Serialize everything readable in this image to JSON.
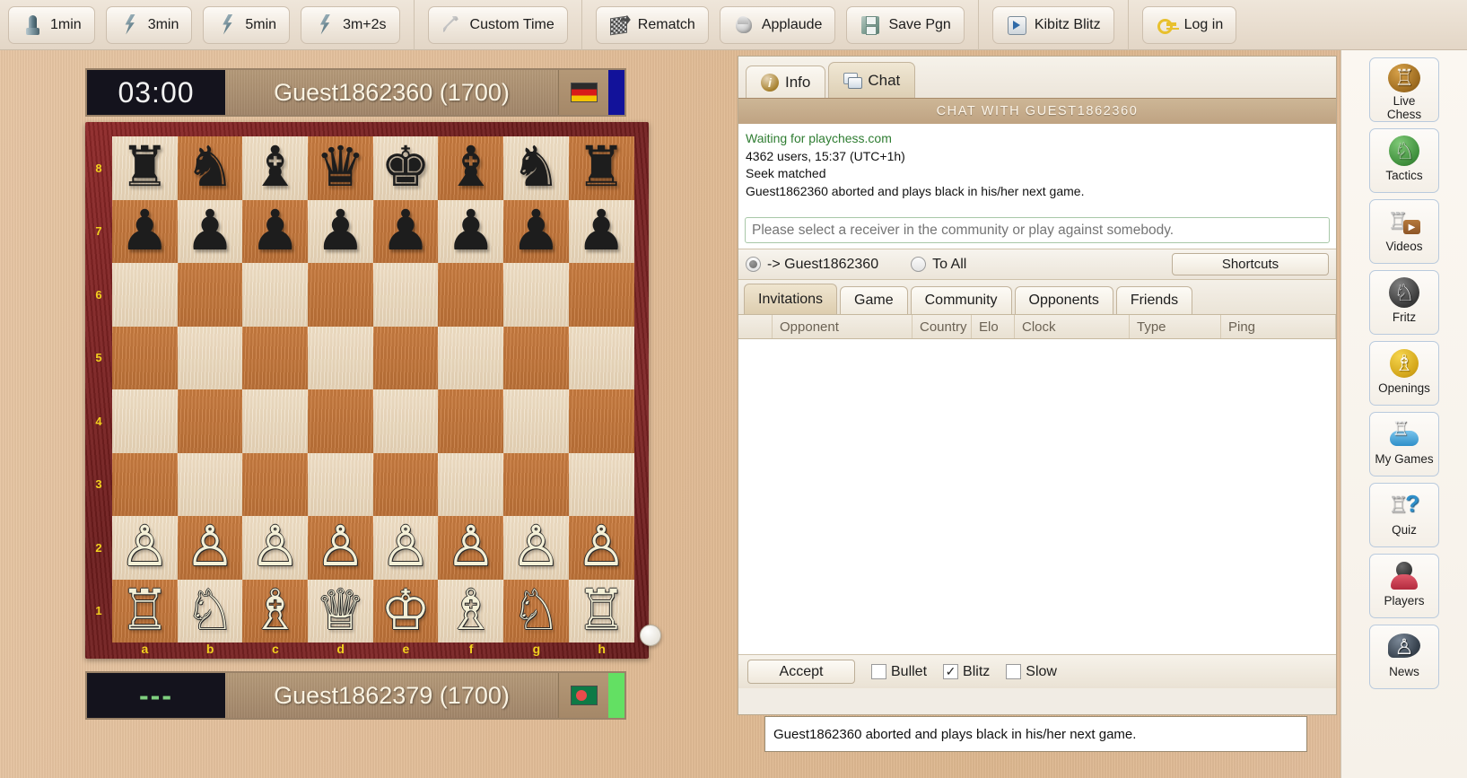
{
  "toolbar": {
    "groups": [
      {
        "buttons": [
          {
            "label": "1min",
            "icon": "bullet-icon"
          },
          {
            "label": "3min",
            "icon": "lightning-icon"
          },
          {
            "label": "5min",
            "icon": "lightning-icon"
          },
          {
            "label": "3m+2s",
            "icon": "lightning-icon"
          }
        ]
      },
      {
        "buttons": [
          {
            "label": "Custom Time",
            "icon": "wrench-icon"
          }
        ]
      },
      {
        "buttons": [
          {
            "label": "Rematch",
            "icon": "rematch-icon"
          },
          {
            "label": "Applaude",
            "icon": "applaud-hand-icon"
          },
          {
            "label": "Save Pgn",
            "icon": "floppy-disk-icon"
          }
        ]
      },
      {
        "buttons": [
          {
            "label": "Kibitz Blitz",
            "icon": "play-lightning-icon"
          }
        ]
      },
      {
        "buttons": [
          {
            "label": "Log in",
            "icon": "key-icon"
          }
        ]
      }
    ]
  },
  "board": {
    "top_player": {
      "clock": "03:00",
      "name": "Guest1862360 (1700)",
      "rating": 1700,
      "flag": "germany-flag",
      "clock_state": "running"
    },
    "bottom_player": {
      "clock": "---",
      "name": "Guest1862379 (1700)",
      "rating": 1700,
      "flag": "bangladesh-flag",
      "clock_state": "idle"
    },
    "orientation": "white-bottom",
    "turn_indicator": "white",
    "rank_labels": [
      "8",
      "7",
      "6",
      "5",
      "4",
      "3",
      "2",
      "1"
    ],
    "file_labels": [
      "a",
      "b",
      "c",
      "d",
      "e",
      "f",
      "g",
      "h"
    ],
    "position": [
      [
        "r",
        "n",
        "b",
        "q",
        "k",
        "b",
        "n",
        "r"
      ],
      [
        "p",
        "p",
        "p",
        "p",
        "p",
        "p",
        "p",
        "p"
      ],
      [
        "",
        "",
        "",
        "",
        "",
        "",
        "",
        ""
      ],
      [
        "",
        "",
        "",
        "",
        "",
        "",
        "",
        ""
      ],
      [
        "",
        "",
        "",
        "",
        "",
        "",
        "",
        ""
      ],
      [
        "",
        "",
        "",
        "",
        "",
        "",
        "",
        ""
      ],
      [
        "P",
        "P",
        "P",
        "P",
        "P",
        "P",
        "P",
        "P"
      ],
      [
        "R",
        "N",
        "B",
        "Q",
        "K",
        "B",
        "N",
        "R"
      ]
    ],
    "colors": {
      "light_square": "#ece0c4",
      "dark_square": "#c8783e",
      "frame": "#742020"
    }
  },
  "panel": {
    "tabs": [
      {
        "label": "Info",
        "icon": "info-icon",
        "active": false
      },
      {
        "label": "Chat",
        "icon": "chat-icon",
        "active": true
      }
    ],
    "chat_title": "CHAT WITH GUEST1862360",
    "chat_log": [
      {
        "text": "Waiting for playchess.com",
        "style": "green"
      },
      {
        "text": "4362 users, 15:37 (UTC+1h)",
        "style": "normal"
      },
      {
        "text": "Seek matched",
        "style": "normal"
      },
      {
        "text": "Guest1862360 aborted and plays black in his/her next game.",
        "style": "normal"
      }
    ],
    "chat_input": {
      "value": "",
      "placeholder": "Please select a receiver in the community or play against somebody."
    },
    "receiver": {
      "options": [
        {
          "label": "-> Guest1862360",
          "selected": true
        },
        {
          "label": "To All",
          "selected": false
        }
      ],
      "shortcuts_label": "Shortcuts"
    },
    "list_tabs": [
      {
        "label": "Invitations",
        "active": true
      },
      {
        "label": "Game",
        "active": false
      },
      {
        "label": "Community",
        "active": false
      },
      {
        "label": "Opponents",
        "active": false
      },
      {
        "label": "Friends",
        "active": false
      }
    ],
    "table": {
      "columns": [
        "",
        "Opponent",
        "Country",
        "Elo",
        "Clock",
        "Type",
        "Ping"
      ],
      "rows": []
    },
    "footer": {
      "accept_label": "Accept",
      "filters": [
        {
          "label": "Bullet",
          "checked": false
        },
        {
          "label": "Blitz",
          "checked": true
        },
        {
          "label": "Slow",
          "checked": false
        }
      ]
    }
  },
  "statusbar": {
    "text": "Guest1862360 aborted and plays black in his/her next game."
  },
  "sidebar": {
    "items": [
      {
        "label": "Live\nChess",
        "icon": "live-chess-icon"
      },
      {
        "label": "Tactics",
        "icon": "tactics-knight-icon"
      },
      {
        "label": "Videos",
        "icon": "videos-play-icon"
      },
      {
        "label": "Fritz",
        "icon": "fritz-knight-icon"
      },
      {
        "label": "Openings",
        "icon": "openings-bishop-icon"
      },
      {
        "label": "My Games",
        "icon": "my-games-cloud-icon"
      },
      {
        "label": "Quiz",
        "icon": "quiz-question-icon"
      },
      {
        "label": "Players",
        "icon": "players-avatar-icon"
      },
      {
        "label": "News",
        "icon": "news-speech-bubble-icon"
      }
    ]
  },
  "theme": {
    "desk_wood": "#e2bd97",
    "toolbar_bg": "#e9ddcd",
    "panel_bg": "#f1ece4",
    "chat_title_bg": "#c4ab8a",
    "accent_green": "#2f7d32",
    "board_frame": "#742020"
  }
}
